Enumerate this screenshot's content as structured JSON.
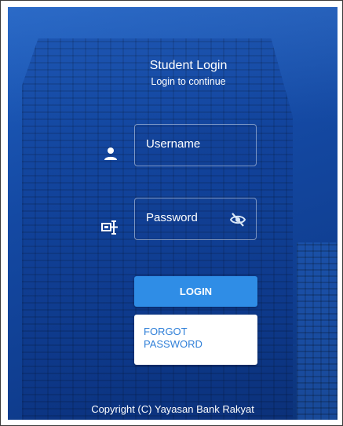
{
  "header": {
    "title": "Student Login",
    "subtitle": "Login to continue"
  },
  "form": {
    "username": {
      "placeholder": "Username",
      "icon": "person-icon"
    },
    "password": {
      "placeholder": "Password",
      "icon": "id-card-icon",
      "toggle_icon": "eye-off-icon"
    }
  },
  "buttons": {
    "login_label": "LOGIN",
    "forgot_line1": "FORGOT",
    "forgot_line2": "PASSWORD"
  },
  "footer": {
    "copyright": "Copyright (C) Yayasan Bank Rakyat"
  },
  "colors": {
    "background": "#1449a3",
    "primary_button": "#2f8de6",
    "link_text": "#2f7fd8"
  }
}
